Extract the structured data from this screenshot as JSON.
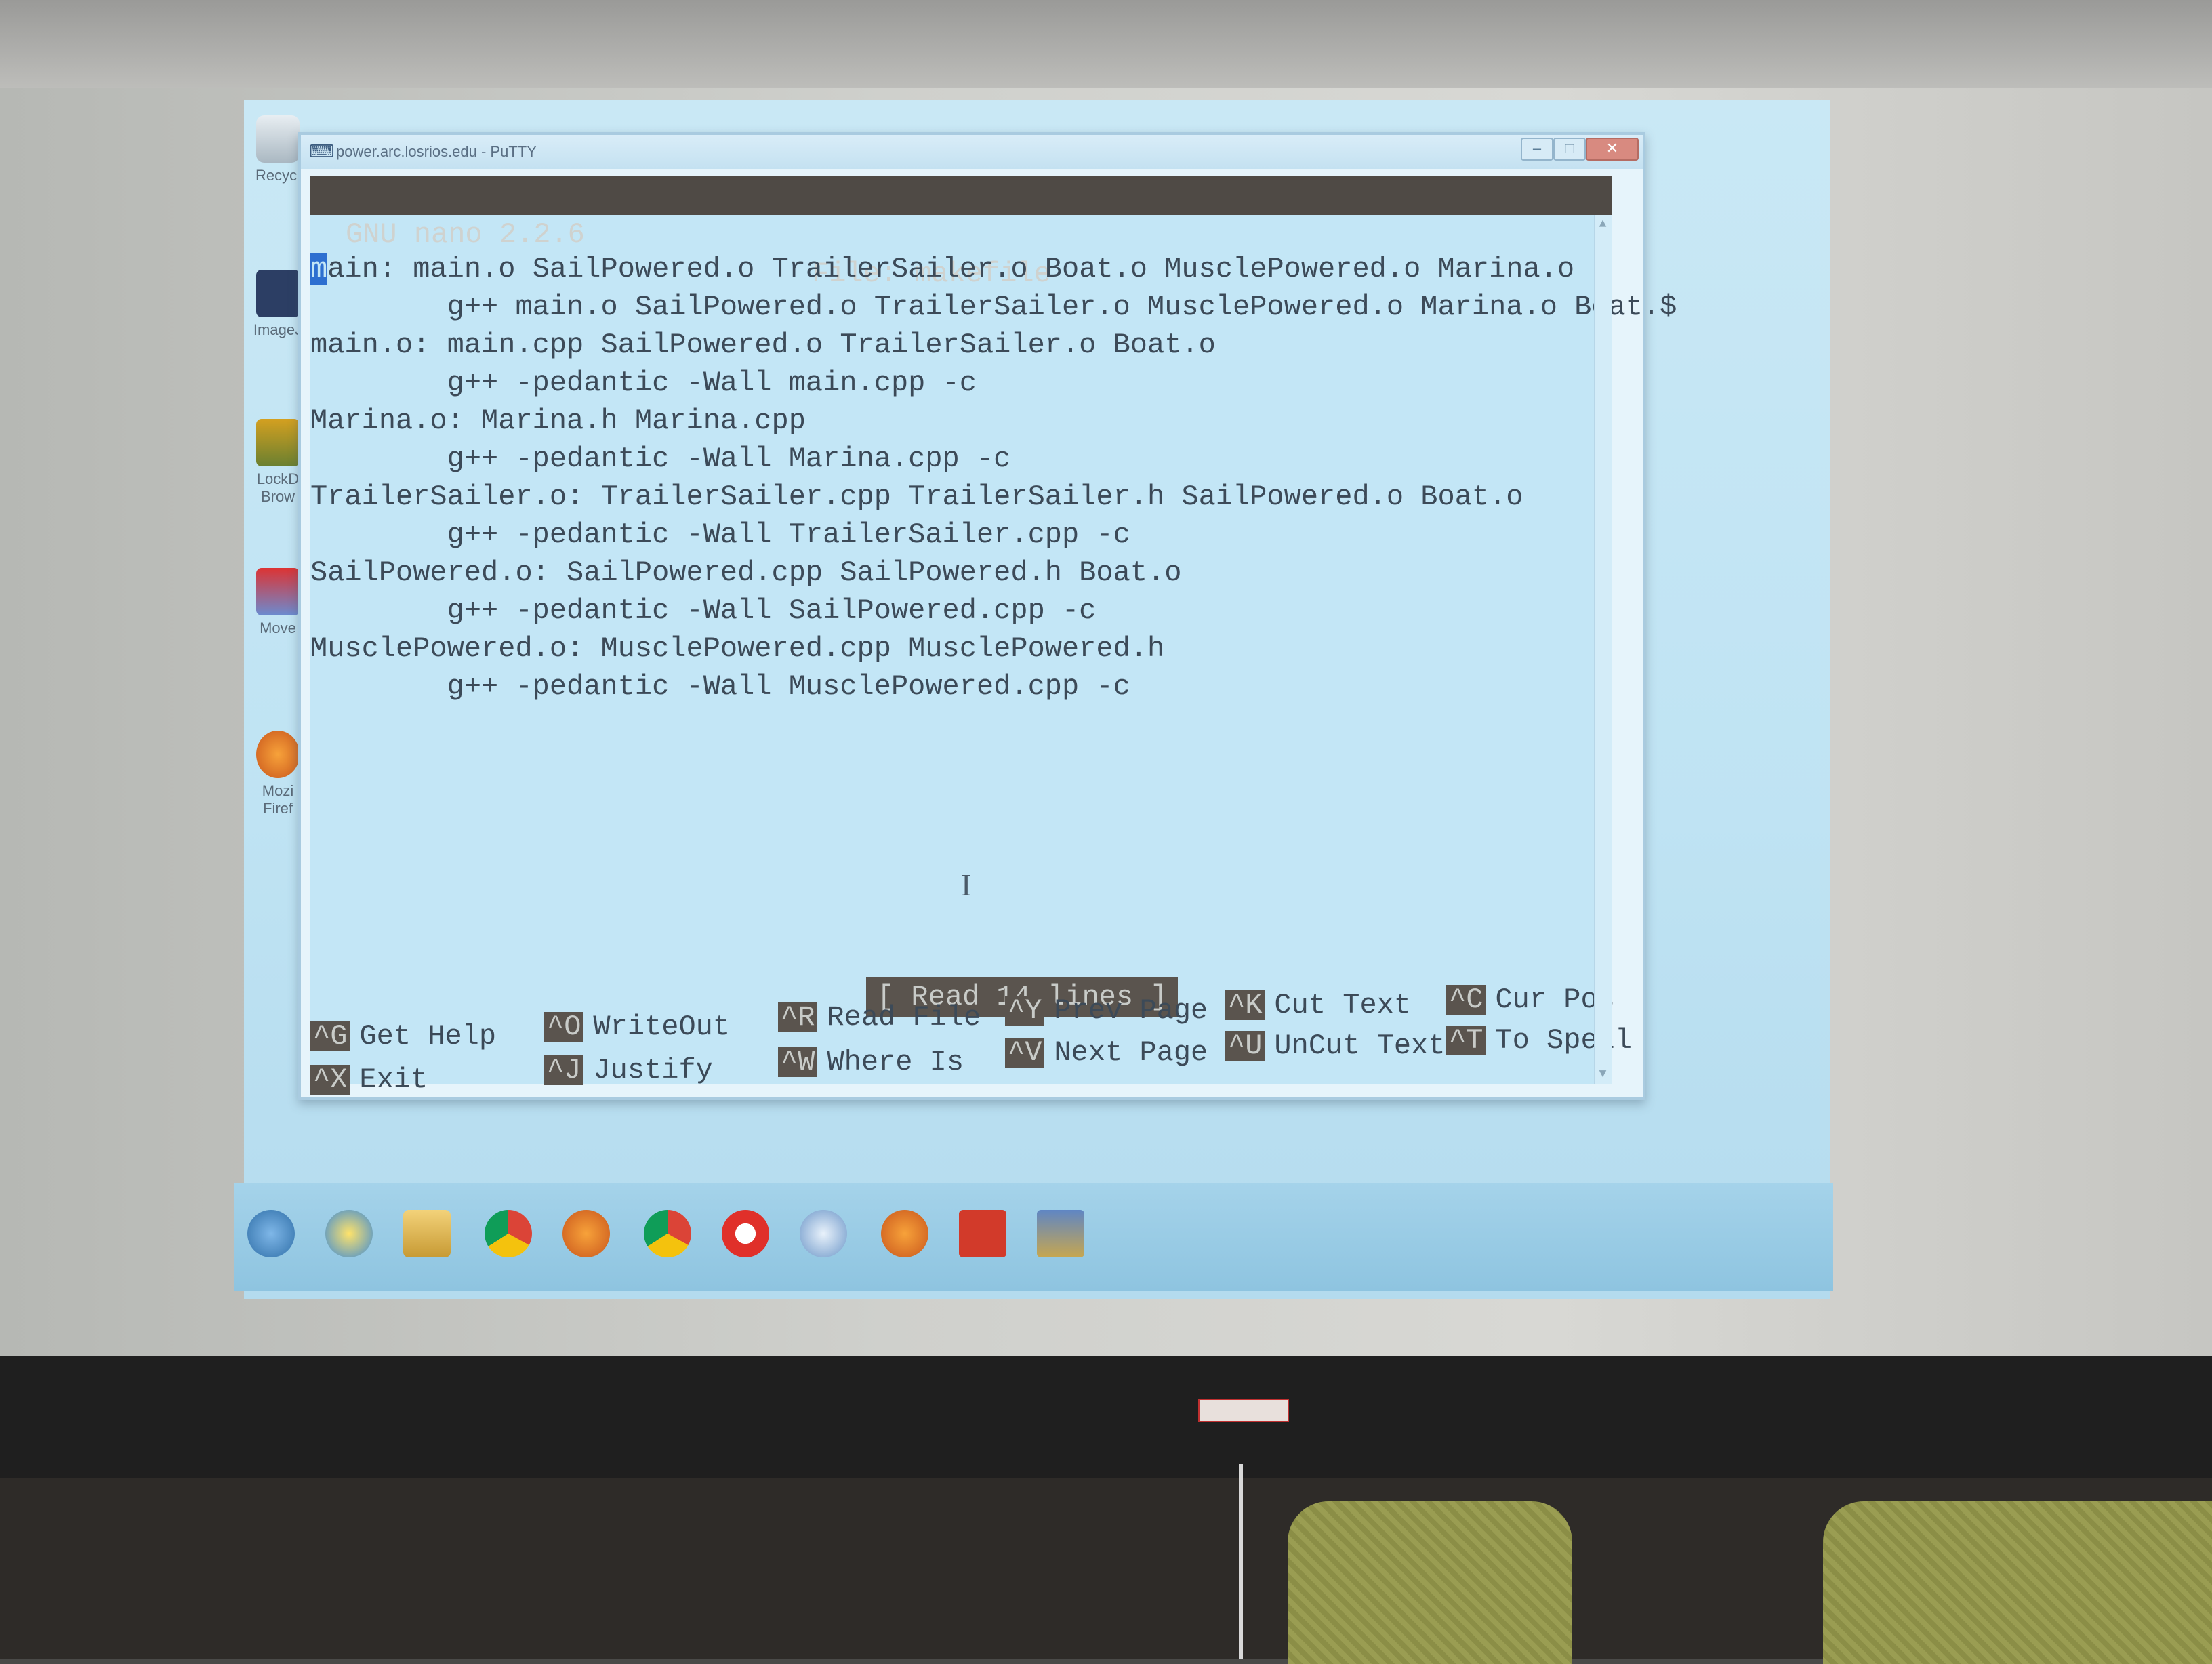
{
  "window": {
    "title": "power.arc.losrios.edu - PuTTY"
  },
  "desktop_icons": [
    {
      "name": "recycle-bin-icon",
      "label": "Recycl"
    },
    {
      "name": "imagej-icon",
      "label": "ImageJ"
    },
    {
      "name": "lockdown-browser-icon",
      "label": "LockD Brow"
    },
    {
      "name": "move-icon",
      "label": "Move"
    },
    {
      "name": "firefox-icon",
      "label": "Mozi Firef"
    }
  ],
  "nano": {
    "version": "GNU nano 2.2.6",
    "file_label": "File: makefile",
    "status_message": "[ Read 14 lines ]",
    "lines": [
      "main: main.o SailPowered.o TrailerSailer.o Boat.o MusclePowered.o Marina.o",
      "        g++ main.o SailPowered.o TrailerSailer.o MusclePowered.o Marina.o Boat.$",
      "main.o: main.cpp SailPowered.o TrailerSailer.o Boat.o",
      "        g++ -pedantic -Wall main.cpp -c",
      "Marina.o: Marina.h Marina.cpp",
      "        g++ -pedantic -Wall Marina.cpp -c",
      "TrailerSailer.o: TrailerSailer.cpp TrailerSailer.h SailPowered.o Boat.o",
      "        g++ -pedantic -Wall TrailerSailer.cpp -c",
      "SailPowered.o: SailPowered.cpp SailPowered.h Boat.o",
      "        g++ -pedantic -Wall SailPowered.cpp -c",
      "MusclePowered.o: MusclePowered.cpp MusclePowered.h",
      "        g++ -pedantic -Wall MusclePowered.cpp -c"
    ],
    "shortcuts": [
      {
        "key": "^G",
        "label": "Get Help"
      },
      {
        "key": "^O",
        "label": "WriteOut"
      },
      {
        "key": "^R",
        "label": "Read File"
      },
      {
        "key": "^Y",
        "label": "Prev Page"
      },
      {
        "key": "^K",
        "label": "Cut Text"
      },
      {
        "key": "^C",
        "label": "Cur Pos"
      },
      {
        "key": "^X",
        "label": "Exit"
      },
      {
        "key": "^J",
        "label": "Justify"
      },
      {
        "key": "^W",
        "label": "Where Is"
      },
      {
        "key": "^V",
        "label": "Next Page"
      },
      {
        "key": "^U",
        "label": "UnCut Text"
      },
      {
        "key": "^T",
        "label": "To Spell"
      }
    ]
  },
  "taskbar": {
    "items": [
      "start-button",
      "internet-explorer-icon",
      "file-explorer-icon",
      "chrome-icon",
      "firefox-icon",
      "chrome-icon",
      "opera-icon",
      "safari-icon",
      "firefox-icon",
      "acrobat-icon",
      "putty-icon"
    ]
  },
  "colors": {
    "terminal_bg": "#c3e6f6",
    "terminal_fg": "#3c4a58",
    "header_bg": "#4f4a45",
    "cursor": "#2d6fd0"
  }
}
